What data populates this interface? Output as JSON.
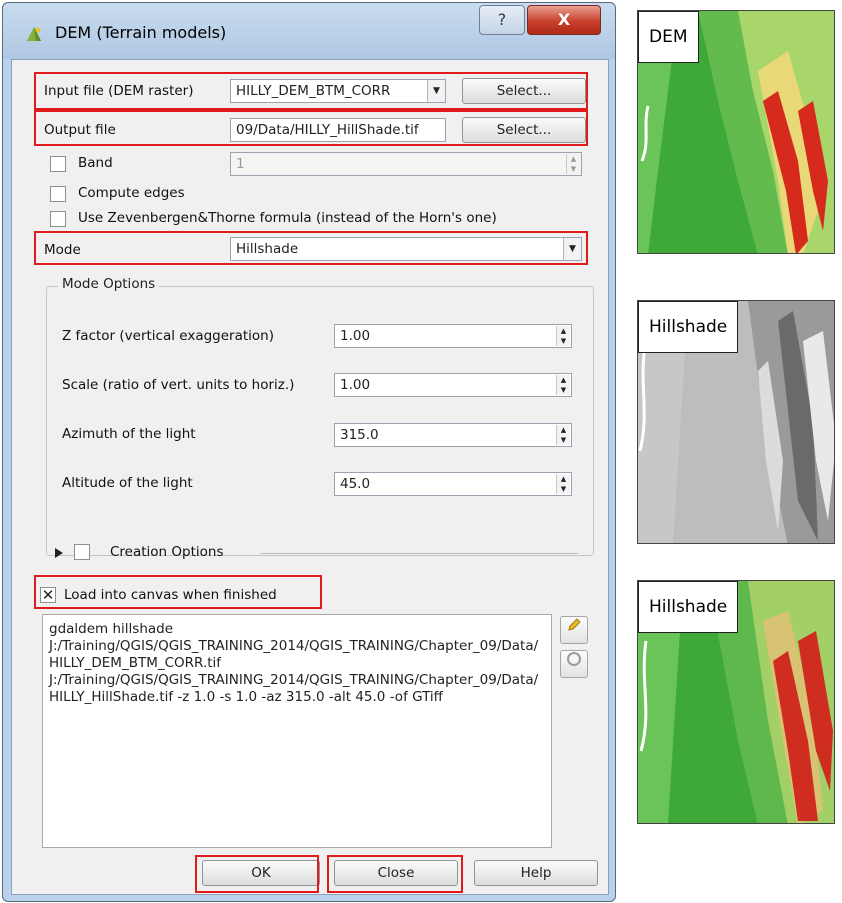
{
  "window": {
    "title": "DEM (Terrain models)",
    "help_glyph": "?",
    "close_glyph": "X"
  },
  "form": {
    "input_label": "Input file (DEM raster)",
    "input_value": "HILLY_DEM_BTM_CORR",
    "input_select": "Select...",
    "output_label": "Output file",
    "output_value": "09/Data/HILLY_HillShade.tif",
    "output_select": "Select...",
    "band_label": "Band",
    "band_value": "1",
    "compute_edges_label": "Compute edges",
    "zevenbergen_label": "Use Zevenbergen&Thorne formula (instead of the Horn's one)",
    "mode_label": "Mode",
    "mode_value": "Hillshade"
  },
  "mode_options": {
    "title": "Mode Options",
    "z_factor_label": "Z factor (vertical exaggeration)",
    "z_factor_value": "1.00",
    "scale_label": "Scale (ratio of vert. units to horiz.)",
    "scale_value": "1.00",
    "azimuth_label": "Azimuth of the light",
    "azimuth_value": "315.0",
    "altitude_label": "Altitude of the light",
    "altitude_value": "45.0"
  },
  "creation_options_label": "Creation Options",
  "load_canvas_label": "Load into canvas when finished",
  "load_canvas_checked": "✕",
  "command_lines": [
    "gdaldem hillshade",
    "J:/Training/QGIS/QGIS_TRAINING_2014/QGIS_TRAINING/Chapter_09/Data/HILLY_DEM_BTM_CORR.tif",
    "J:/Training/QGIS/QGIS_TRAINING_2014/QGIS_TRAINING/Chapter_09/Data/HILLY_HillShade.tif -z 1.0 -s 1.0 -az 315.0 -alt 45.0 -of GTiff"
  ],
  "buttons": {
    "ok": "OK",
    "close": "Close",
    "help": "Help"
  },
  "maps": {
    "dem_label": "DEM",
    "hillshade_label": "Hillshade",
    "hillshade_dem_label": "Hillshade"
  },
  "colors": {
    "highlight_red": "#e11b1b",
    "dem_green": "#3fae3a",
    "dem_red": "#d62a1c"
  },
  "icons": {
    "title": "qgis-icon",
    "edit": "pencil-icon",
    "reset": "reset-icon",
    "expand": "triangle-right-icon"
  }
}
